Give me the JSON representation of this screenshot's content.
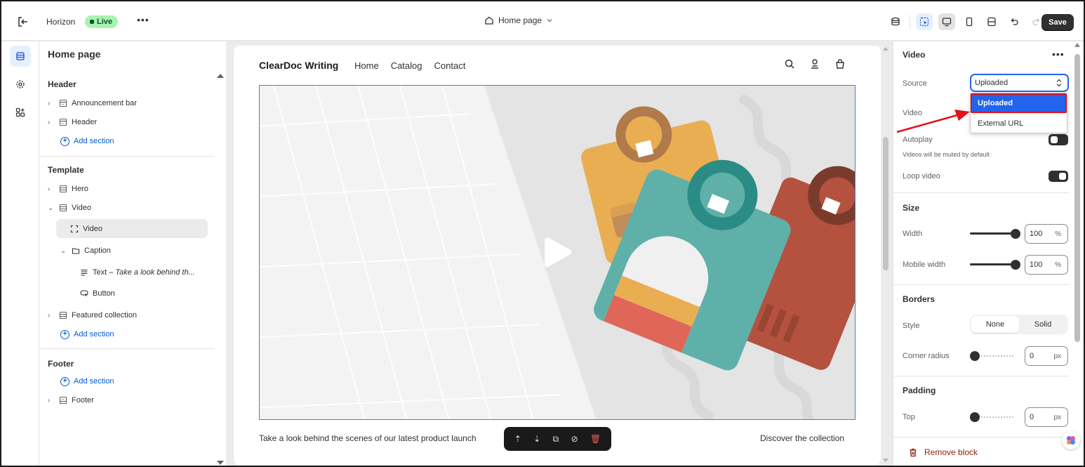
{
  "topbar": {
    "theme_name": "Horizon",
    "live_badge": "Live",
    "more": "•••",
    "page_selector": "Home page",
    "save_label": "Save"
  },
  "sidebar": {
    "title": "Home page",
    "header_group": "Header",
    "header_items": [
      "Announcement bar",
      "Header"
    ],
    "add_section": "Add section",
    "template_group": "Template",
    "template_items": {
      "hero": "Hero",
      "video": "Video",
      "video_block": "Video",
      "caption": "Caption",
      "text_prefix": "Text – ",
      "text_preview": "Take a look behind th...",
      "button": "Button",
      "featured": "Featured collection"
    },
    "footer_group": "Footer",
    "footer_item": "Footer"
  },
  "preview": {
    "brand": "ClearDoc Writing",
    "nav": [
      "Home",
      "Catalog",
      "Contact"
    ],
    "caption": "Take a look behind the scenes of our latest product launch",
    "discover": "Discover the collection"
  },
  "panel": {
    "title": "Video",
    "more": "•••",
    "source_label": "Source",
    "source_value": "Uploaded",
    "source_options": [
      "Uploaded",
      "External URL"
    ],
    "video_label": "Video",
    "autoplay_label": "Autoplay",
    "autoplay_hint": "Videos will be muted by default",
    "autoplay_on": false,
    "loop_label": "Loop video",
    "loop_on": true,
    "size_heading": "Size",
    "width_label": "Width",
    "width_value": "100",
    "width_unit": "%",
    "mobile_width_label": "Mobile width",
    "mobile_width_value": "100",
    "mobile_width_unit": "%",
    "borders_heading": "Borders",
    "style_label": "Style",
    "style_options": [
      "None",
      "Solid"
    ],
    "style_selected": "None",
    "corner_radius_label": "Corner radius",
    "corner_radius_value": "0",
    "corner_radius_unit": "px",
    "padding_heading": "Padding",
    "top_label": "Top",
    "top_value": "0",
    "top_unit": "px",
    "remove_block": "Remove block"
  },
  "colors": {
    "accent": "#2463eb",
    "live_badge": "#a7f3b0",
    "annotation_red": "#e3111b",
    "remove": "#8e1f0b"
  }
}
